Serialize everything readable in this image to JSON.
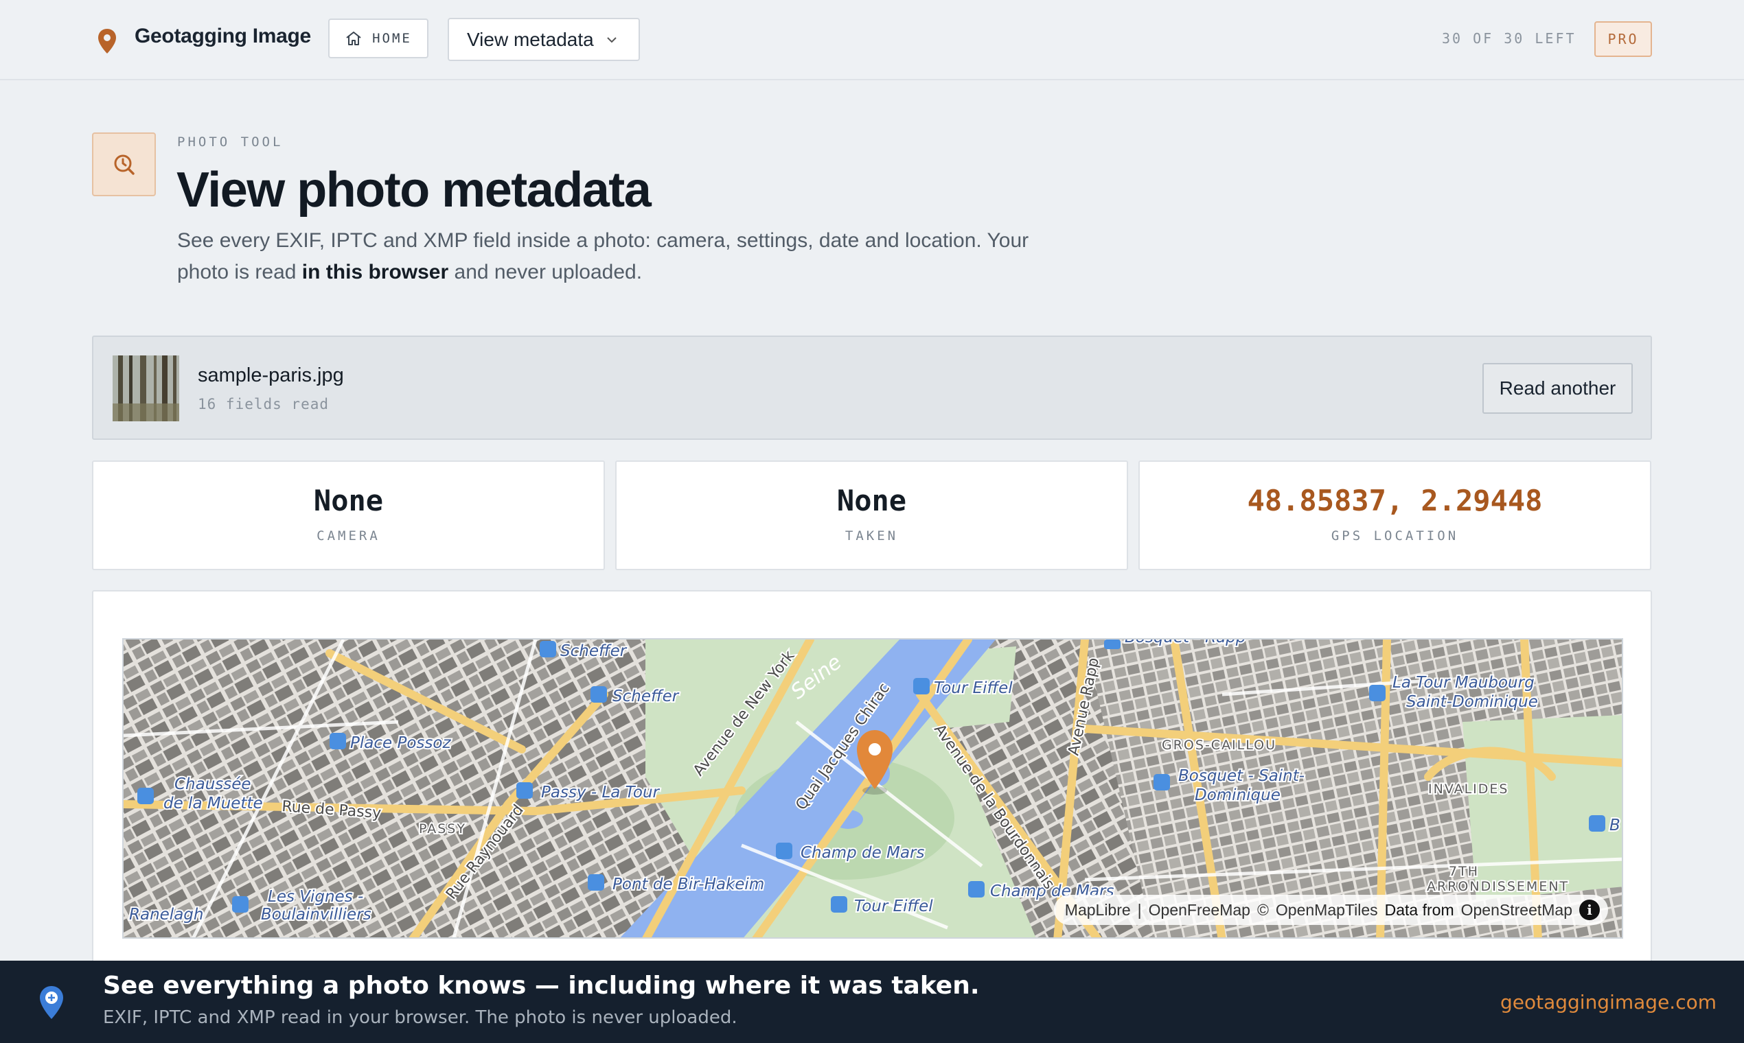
{
  "header": {
    "brand": "Geotagging Image",
    "home_label": "HOME",
    "tool_select": "View metadata",
    "quota": "30 OF 30 LEFT",
    "plan_badge": "PRO"
  },
  "hero": {
    "eyebrow": "PHOTO TOOL",
    "title": "View photo metadata",
    "lede_before": "See every EXIF, IPTC and XMP field inside a photo: camera, settings, date and location. Your photo is read ",
    "lede_bold": "in this browser",
    "lede_after": " and never uploaded."
  },
  "file": {
    "name": "sample-paris.jpg",
    "fields_read": "16 fields read",
    "read_another": "Read another"
  },
  "stats": [
    {
      "value": "None",
      "label": "CAMERA"
    },
    {
      "value": "None",
      "label": "TAKEN"
    },
    {
      "value": "48.85837, 2.29448",
      "label": "GPS LOCATION"
    }
  ],
  "map": {
    "labels": {
      "scheffer1": "Scheffer",
      "scheffer2": "Scheffer",
      "tour_eiffel1": "Tour Eiffel",
      "tour_eiffel2": "Tour Eiffel",
      "bosquet_rapp": "Bosquet - Rapp",
      "tour_maubourg": "La Tour Maubourg",
      "saint_dominique": "Saint-Dominique",
      "place_possoz": "Place Possoz",
      "chaussee": "Chaussée",
      "muette": "de la Muette",
      "passy_latour": "Passy - La Tour",
      "passy": "PASSY",
      "rue_passy": "Rue de Passy",
      "gros_caillou": "GROS-CAILLOU",
      "bosquet_sd1": "Bosquet - Saint-",
      "bosquet_sd2": "Dominique",
      "invalides": "INVALIDES",
      "seine": "Seine",
      "av_new_york": "Avenue de New York",
      "quai_chirac": "Quai Jacques Chirac",
      "av_bourdonnais": "Avenue de la Bourdonnais",
      "av_rapp": "Avenue Rapp",
      "champ_mars1": "Champ de Mars",
      "champ_mars2": "Champ de Mars",
      "bir_hakeim": "Pont de Bir-Hakeim",
      "vignes": "Les Vignes -",
      "boulainvilliers": "Boulainvilliers",
      "ranelagh": "Ranelagh",
      "arr7": "7TH",
      "arrondissement": "ARRONDISSEMENT",
      "rue_raynouard": "Rue Raynouard",
      "b": "B"
    },
    "attribution": {
      "maplibre": "MapLibre",
      "sep": "|",
      "openfreemap": "OpenFreeMap",
      "copy": "©",
      "omt": "OpenMapTiles",
      "data_from": "Data from",
      "osm": "OpenStreetMap"
    },
    "marker_color": "#e2883a"
  },
  "banner": {
    "headline": "See everything a photo knows — including where it was taken.",
    "subline": "EXIF, IPTC and XMP read in your browser. The photo is never uploaded.",
    "link": "geotaggingimage.com"
  },
  "colors": {
    "accent": "#a8581f",
    "banner_bg": "#15202e",
    "link": "#e08a3c"
  }
}
